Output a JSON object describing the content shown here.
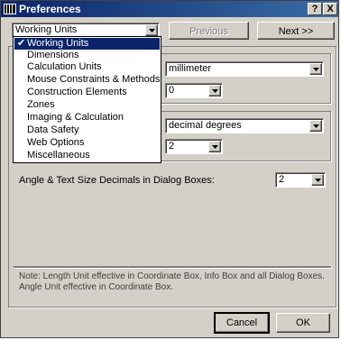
{
  "window": {
    "title": "Preferences",
    "help_label": "?",
    "close_label": "X"
  },
  "category": {
    "selected": "Working Units",
    "options": [
      "Working Units",
      "Dimensions",
      "Calculation Units",
      "Mouse Constraints & Methods",
      "Construction Elements",
      "Zones",
      "Imaging & Calculation",
      "Data Safety",
      "Web Options",
      "Miscellaneous"
    ]
  },
  "nav": {
    "previous_label": "Previous",
    "next_label": "Next >>"
  },
  "length": {
    "unit_value": "millimeter",
    "decimals_value": "0"
  },
  "angle": {
    "unit_value": "decimal degrees",
    "decimals_value": "2"
  },
  "dialog_decimals": {
    "label": "Angle & Text Size Decimals in Dialog Boxes:",
    "value": "2"
  },
  "note": "Note: Length Unit effective in Coordinate Box, Info Box and all Dialog Boxes. Angle Unit effective in Coordinate Box.",
  "footer": {
    "cancel_label": "Cancel",
    "ok_label": "OK"
  },
  "colors": {
    "titlebar": "#0a246a",
    "selection": "#0a246a",
    "face": "#d4d0c8"
  },
  "icons": {
    "app": "app-window-icon",
    "check": "check-icon",
    "dropdown": "chevron-down-icon"
  }
}
